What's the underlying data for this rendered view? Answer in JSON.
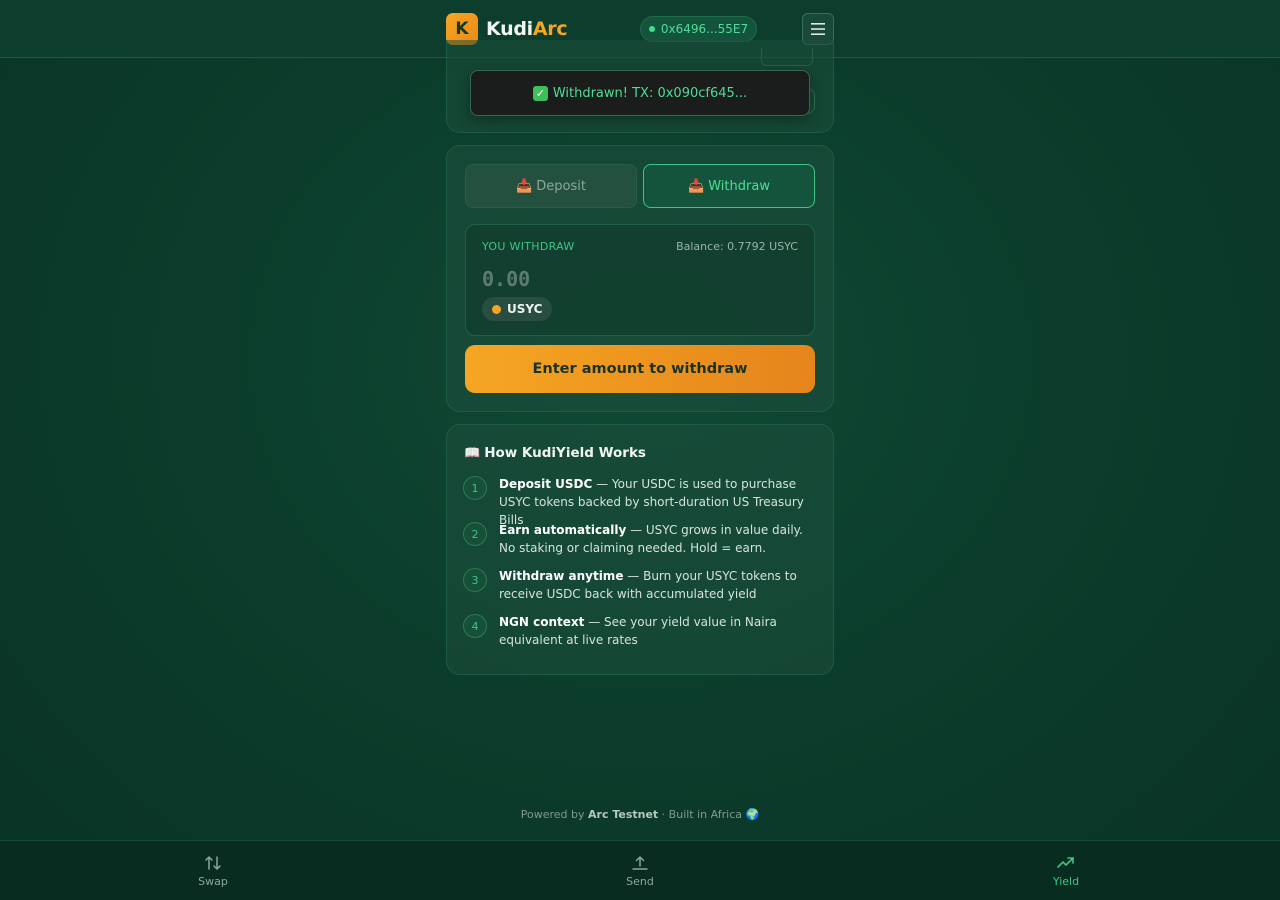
{
  "header": {
    "logo_letter": "K",
    "logo_kudi": "Kudi",
    "logo_arc": "Arc",
    "wallet_address": "0x6496...55E7",
    "menu_icon": "hamburger-menu-icon",
    "accent": "#f5a623"
  },
  "toast": {
    "icon": "check-box-icon",
    "check_glyph": "✓",
    "message": "Withdrawn! TX: 0x090cf645..."
  },
  "tabs": [
    {
      "label": "Deposit",
      "icon": "inbox-tray-icon",
      "glyph": "📥",
      "active": false
    },
    {
      "label": "Withdraw",
      "icon": "inbox-tray-icon",
      "glyph": "📥",
      "active": true
    }
  ],
  "withdraw_form": {
    "label": "YOU WITHDRAW",
    "balance": "Balance: 0.7792 USYC",
    "amount_placeholder": "0.00",
    "token": "USYC",
    "token_color": "#f5a623",
    "cta_label": "Enter amount to withdraw"
  },
  "how_it_works": {
    "icon": "open-book-icon",
    "glyph": "📖",
    "title": "How KudiYield Works",
    "steps": [
      {
        "num": "1",
        "title": "Deposit USDC",
        "text": " — Your USDC is used to purchase USYC tokens backed by short-duration US Treasury Bills"
      },
      {
        "num": "2",
        "title": "Earn automatically",
        "text": " — USYC grows in value daily. No staking or claiming needed. Hold = earn."
      },
      {
        "num": "3",
        "title": "Withdraw anytime",
        "text": " — Burn your USYC tokens to receive USDC back with accumulated yield"
      },
      {
        "num": "4",
        "title": "NGN context",
        "text": " — See your yield value in Naira equivalent at live rates"
      }
    ]
  },
  "footer": {
    "prefix": "Powered by ",
    "network": "Arc Testnet",
    "suffix": " · Built in Africa ",
    "globe": "🌍"
  },
  "bottom_nav": [
    {
      "label": "Swap",
      "icon": "swap-arrows-icon",
      "active": false
    },
    {
      "label": "Send",
      "icon": "upload-icon",
      "active": false
    },
    {
      "label": "Yield",
      "icon": "trending-up-icon",
      "active": true
    }
  ]
}
